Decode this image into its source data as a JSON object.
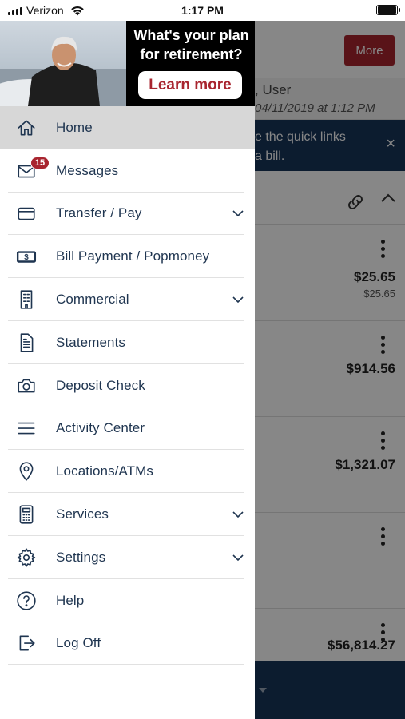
{
  "status_bar": {
    "carrier": "Verizon",
    "time": "1:17 PM",
    "battery_level": 1.0
  },
  "promo": {
    "title": "What's your plan for retirement?",
    "button": "Learn more"
  },
  "menu": [
    {
      "label": "Home",
      "icon": "home-icon",
      "active": true,
      "expandable": false
    },
    {
      "label": "Messages",
      "icon": "envelope-icon",
      "badge": "15",
      "expandable": false
    },
    {
      "label": "Transfer / Pay",
      "icon": "card-icon",
      "expandable": true
    },
    {
      "label": "Bill Payment / Popmoney",
      "icon": "dollar-bill-icon",
      "expandable": false
    },
    {
      "label": "Commercial",
      "icon": "building-icon",
      "expandable": true
    },
    {
      "label": "Statements",
      "icon": "document-icon",
      "expandable": false
    },
    {
      "label": "Deposit Check",
      "icon": "camera-icon",
      "expandable": false
    },
    {
      "label": "Activity Center",
      "icon": "list-lines-icon",
      "expandable": false
    },
    {
      "label": "Locations/ATMs",
      "icon": "location-pin-icon",
      "expandable": false
    },
    {
      "label": "Services",
      "icon": "calculator-icon",
      "expandable": true
    },
    {
      "label": "Settings",
      "icon": "gear-icon",
      "expandable": true
    },
    {
      "label": "Help",
      "icon": "help-circle-icon",
      "expandable": false
    },
    {
      "label": "Log Off",
      "icon": "logout-icon",
      "expandable": false
    }
  ],
  "background": {
    "more_button": "More",
    "greeting": ", User",
    "last_login": "04/11/2019 at 1:12 PM",
    "banner_text": "e the quick links\na bill.",
    "close": "×",
    "accounts": [
      {
        "amount": "$25.65",
        "sub": "$25.65"
      },
      {
        "amount": "$914.56",
        "sub": ""
      },
      {
        "amount": "$1,321.07",
        "sub": ""
      },
      {
        "amount": "",
        "sub": ""
      },
      {
        "amount": "$56,814.27",
        "sub": ""
      }
    ]
  },
  "colors": {
    "brand_red": "#a8252f",
    "navy": "#17355a",
    "menu_text": "#1f3550",
    "active_bg": "#d7d7d7"
  }
}
